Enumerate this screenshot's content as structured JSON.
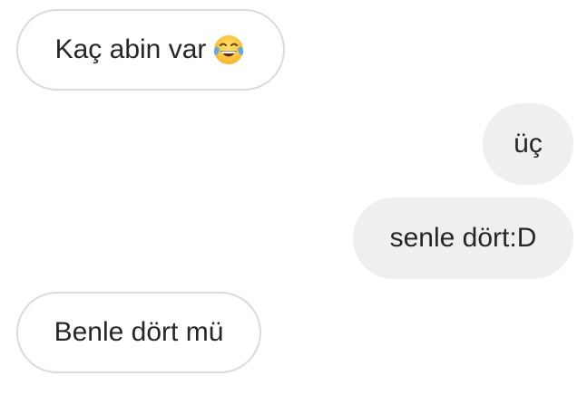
{
  "messages": [
    {
      "sender": "other",
      "text": "Kaç abin var",
      "emoji": "face-with-tears-of-joy-icon"
    },
    {
      "sender": "me",
      "text": "üç"
    },
    {
      "sender": "me",
      "text": "senle dört:D"
    },
    {
      "sender": "other",
      "text": "Benle dört mü"
    }
  ],
  "colors": {
    "incoming_bubble_bg": "#ffffff",
    "incoming_bubble_border": "#dbdbdb",
    "outgoing_bubble_bg": "#efefef",
    "text": "#262626"
  }
}
